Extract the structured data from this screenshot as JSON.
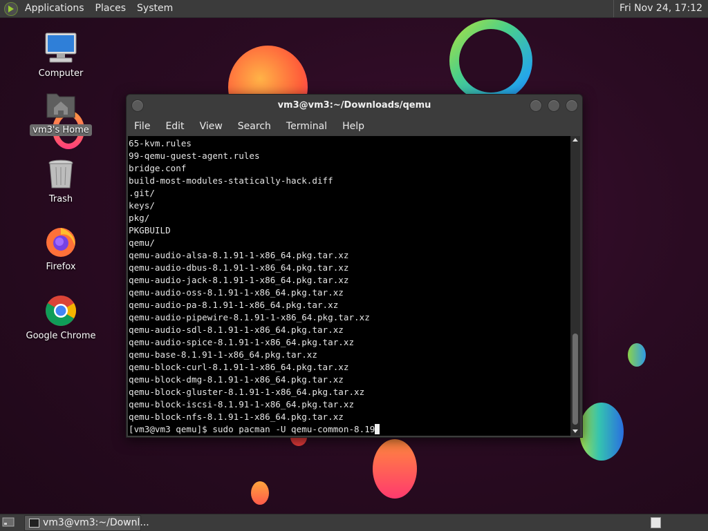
{
  "top_panel": {
    "menus": [
      "Applications",
      "Places",
      "System"
    ],
    "clock": "Fri Nov 24, 17:12"
  },
  "desktop": {
    "icons": [
      {
        "label": "Computer",
        "icon": "computer-icon"
      },
      {
        "label": "vm3's Home",
        "icon": "home-folder-icon"
      },
      {
        "label": "Trash",
        "icon": "trash-icon"
      },
      {
        "label": "Firefox",
        "icon": "firefox-icon"
      },
      {
        "label": "Google Chrome",
        "icon": "chrome-icon"
      }
    ]
  },
  "terminal": {
    "title": "vm3@vm3:~/Downloads/qemu",
    "menus": [
      "File",
      "Edit",
      "View",
      "Search",
      "Terminal",
      "Help"
    ],
    "lines": [
      "65-kvm.rules",
      "99-qemu-guest-agent.rules",
      "bridge.conf",
      "build-most-modules-statically-hack.diff",
      ".git/",
      "keys/",
      "pkg/",
      "PKGBUILD",
      "qemu/",
      "qemu-audio-alsa-8.1.91-1-x86_64.pkg.tar.xz",
      "qemu-audio-dbus-8.1.91-1-x86_64.pkg.tar.xz",
      "qemu-audio-jack-8.1.91-1-x86_64.pkg.tar.xz",
      "qemu-audio-oss-8.1.91-1-x86_64.pkg.tar.xz",
      "qemu-audio-pa-8.1.91-1-x86_64.pkg.tar.xz",
      "qemu-audio-pipewire-8.1.91-1-x86_64.pkg.tar.xz",
      "qemu-audio-sdl-8.1.91-1-x86_64.pkg.tar.xz",
      "qemu-audio-spice-8.1.91-1-x86_64.pkg.tar.xz",
      "qemu-base-8.1.91-1-x86_64.pkg.tar.xz",
      "qemu-block-curl-8.1.91-1-x86_64.pkg.tar.xz",
      "qemu-block-dmg-8.1.91-1-x86_64.pkg.tar.xz",
      "qemu-block-gluster-8.1.91-1-x86_64.pkg.tar.xz",
      "qemu-block-iscsi-8.1.91-1-x86_64.pkg.tar.xz",
      "qemu-block-nfs-8.1.91-1-x86_64.pkg.tar.xz"
    ],
    "prompt": "[vm3@vm3 qemu]$ ",
    "command": "sudo pacman -U qemu-common-8.19"
  },
  "bottom_panel": {
    "task_label": "vm3@vm3:~/Downl..."
  },
  "colors": {
    "panel": "#3b3b3b",
    "terminal_bg": "#000000",
    "terminal_fg": "#e6e6e6"
  }
}
